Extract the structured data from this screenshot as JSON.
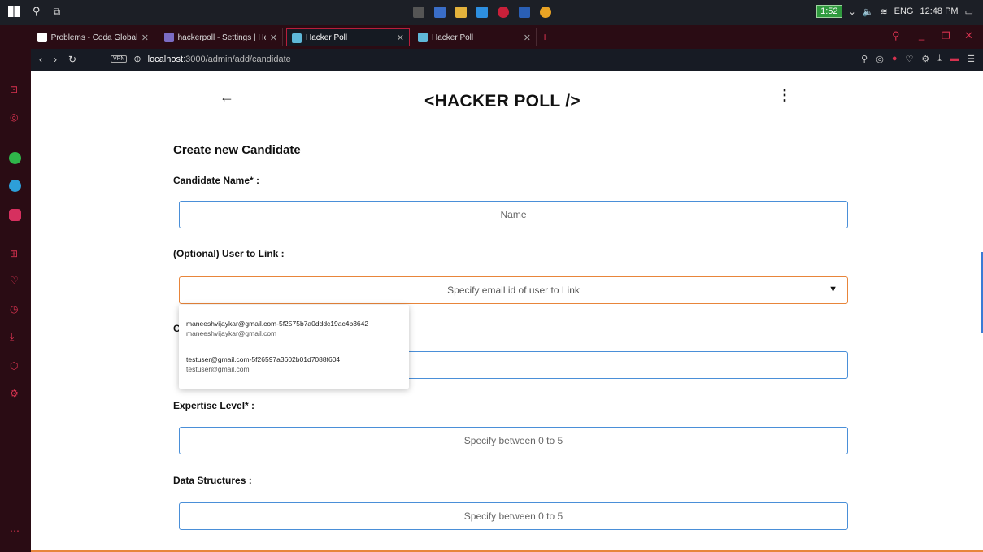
{
  "taskbar": {
    "battery": "1:52",
    "lang": "ENG",
    "time": "12:48 PM"
  },
  "tabs": [
    {
      "label": "Problems - Coda Global Fu",
      "close": "✕"
    },
    {
      "label": "hackerpoll - Settings | Hero",
      "close": "✕"
    },
    {
      "label": "Hacker Poll",
      "close": "✕"
    },
    {
      "label": "Hacker Poll",
      "close": "✕"
    }
  ],
  "address": {
    "vpn": "VPN",
    "host": "localhost",
    "path": ":3000/admin/add/candidate"
  },
  "header": {
    "back": "←",
    "brand": "<HACKER POLL />",
    "menu": "⋮"
  },
  "form": {
    "title": "Create new Candidate",
    "name_label": "Candidate Name* :",
    "name_placeholder": "Name",
    "link_label": "(Optional) User to Link :",
    "link_placeholder": "Specify email id of user to Link",
    "partial_label": "C",
    "expertise_label": "Expertise Level* :",
    "expertise_placeholder": "Specify between 0 to 5",
    "ds_label": "Data Structures :",
    "ds_placeholder": "Specify between 0 to 5"
  },
  "suggestions": [
    {
      "primary": "maneeshvijaykar@gmail.com-5f2575b7a0dddc19ac4b3642",
      "secondary": "maneeshvijaykar@gmail.com"
    },
    {
      "primary": "testuser@gmail.com-5f26597a3602b01d7088f604",
      "secondary": "testuser@gmail.com"
    }
  ]
}
